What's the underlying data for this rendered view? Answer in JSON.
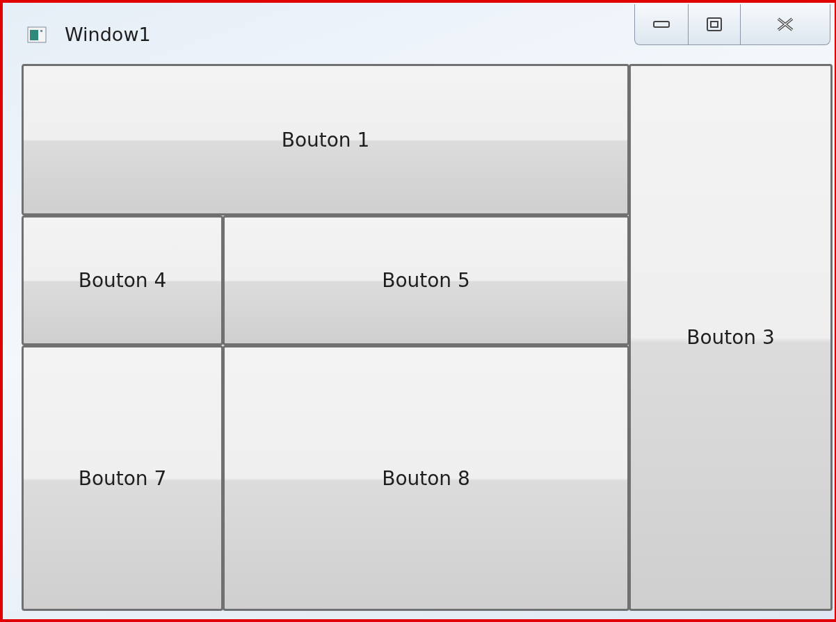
{
  "window": {
    "title": "Window1"
  },
  "grid": {
    "top_button": "Bouton 1",
    "side_button": "Bouton 3",
    "rows": [
      [
        "Bouton 4",
        "Bouton 5"
      ],
      [
        "Bouton 7",
        "Bouton 8"
      ]
    ]
  }
}
